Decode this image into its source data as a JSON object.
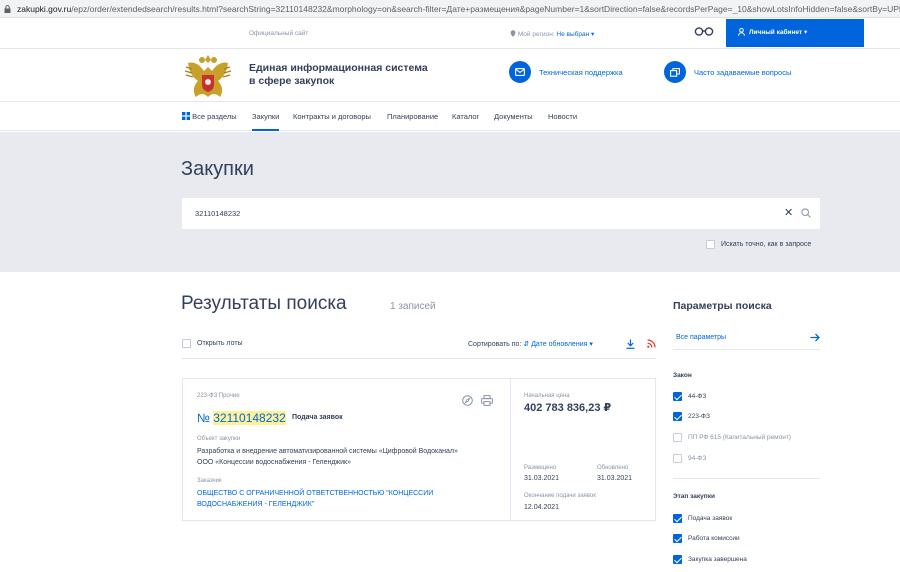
{
  "browser": {
    "host": "zakupki.gov.ru",
    "path": "/epz/order/extendedsearch/results.html?searchString=32110148232&morphology=on&search-filter=Дате+размещения&pageNumber=1&sortDirection=false&recordsPerPage=_10&showLotsInfoHidden=false&sortBy=UPDATE_D"
  },
  "topbar": {
    "official": "Официальный сайт",
    "region_label": "Мой регион:",
    "region_value": "Не выбран",
    "cabinet": "Личный кабинет"
  },
  "header": {
    "title_line1": "Единая информационная система",
    "title_line2": "в сфере закупок",
    "support": "Техническая поддержка",
    "faq": "Часто задаваемые вопросы"
  },
  "nav": {
    "items": [
      "Все разделы",
      "Закупки",
      "Контракты и договоры",
      "Планирование",
      "Каталог",
      "Документы",
      "Новости"
    ]
  },
  "search": {
    "heading": "Закупки",
    "query": "32110148232",
    "exact": "Искать точно, как в запросе"
  },
  "results": {
    "heading": "Результаты поиска",
    "count": "1 записей",
    "open_lots": "Открыть лоты",
    "sort_label": "Сортировать по:",
    "sort_value": "Дате обновления"
  },
  "card": {
    "law": "223-ФЗ Прочие",
    "num_prefix": "№",
    "number": "32110148232",
    "stage": "Подача заявок",
    "object_label": "Объект закупки",
    "object_text": "Разработка и внедрение автоматизированной системы «Цифровой Водоканал»",
    "object_text2": "ООО «Концессии водоснабжения - Геленджик»",
    "customer_label": "Заказчик",
    "customer_line1": "ОБЩЕСТВО С ОГРАНИЧЕННОЙ ОТВЕТСТВЕННОСТЬЮ \"КОНЦЕССИИ",
    "customer_line2": "ВОДОСНАБЖЕНИЯ - ГЕЛЕНДЖИК\"",
    "price_label": "Начальная цена",
    "price": "402 783 836,23 ₽",
    "placed_label": "Размещено",
    "placed": "31.03.2021",
    "updated_label": "Обновлено",
    "updated": "31.03.2021",
    "deadline_label": "Окончание подачи заявок",
    "deadline": "12.04.2021"
  },
  "params": {
    "heading": "Параметры поиска",
    "all": "Все параметры",
    "law_heading": "Закон",
    "laws": [
      {
        "label": "44-ФЗ",
        "checked": true
      },
      {
        "label": "223-ФЗ",
        "checked": true
      },
      {
        "label": "ПП РФ 615 (Капитальный ремонт)",
        "checked": false
      },
      {
        "label": "94-ФЗ",
        "checked": false
      }
    ],
    "stage_heading": "Этап закупки",
    "stages": [
      {
        "label": "Подача заявок",
        "checked": true
      },
      {
        "label": "Работа комиссии",
        "checked": true
      },
      {
        "label": "Закупка завершена",
        "checked": true
      }
    ]
  },
  "colors": {
    "accent": "#0065dd",
    "band": "#e8eaf0",
    "text": "#334059",
    "muted": "#8a94a6"
  }
}
